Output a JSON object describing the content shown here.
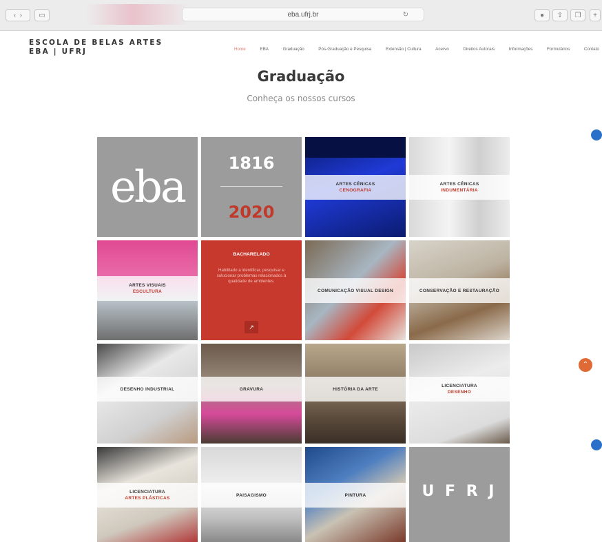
{
  "browser": {
    "url": "eba.ufrj.br"
  },
  "header": {
    "brand_line1": "ESCOLA DE BELAS ARTES",
    "brand_line2": "EBA | UFRJ",
    "nav": [
      "Home",
      "EBA",
      "Graduação",
      "Pós-Graduação e Pesquisa",
      "Extensão | Cultura",
      "Acervo",
      "Direitos Autorais",
      "Informações",
      "Formulários",
      "Contato"
    ]
  },
  "page": {
    "title": "Graduação",
    "subtitle": "Conheça os nossos cursos"
  },
  "tiles": {
    "logo": "eba",
    "year_top": "1816",
    "year_bottom": "2020",
    "cenicas_cenografia": {
      "line1": "ARTES CÊNICAS",
      "line2": "CENOGRAFIA"
    },
    "cenicas_indumentaria": {
      "line1": "ARTES CÊNICAS",
      "line2": "INDUMENTÁRIA"
    },
    "visuais_escultura": {
      "line1": "ARTES VISUAIS",
      "line2": "ESCULTURA"
    },
    "bacharelado": {
      "title": "BACHARELADO",
      "text": "Habilitado a identificar, pesquisar e solucionar problemas relacionados à qualidade de ambientes."
    },
    "comunicacao": {
      "line1": "COMUNICAÇÃO VISUAL DESIGN"
    },
    "conservacao": {
      "line1": "CONSERVAÇÃO E RESTAURAÇÃO"
    },
    "desenho_industrial": {
      "line1": "DESENHO INDUSTRIAL"
    },
    "gravura": {
      "line1": "GRAVURA"
    },
    "historia": {
      "line1": "HISTÓRIA DA ARTE"
    },
    "lic_desenho": {
      "line1": "LICENCIATURA",
      "line2": "DESENHO"
    },
    "lic_artes": {
      "line1": "LICENCIATURA",
      "line2": "ARTES PLÁSTICAS"
    },
    "paisagismo": {
      "line1": "PAISAGISMO"
    },
    "pintura": {
      "line1": "PINTURA"
    },
    "ufrj": "U F R J"
  },
  "colors": {
    "accent_red": "#c0392b",
    "gray_tile": "#9e9e9e",
    "scroll_top_button": "#e06a35",
    "side_badge": "#2a70c8"
  }
}
